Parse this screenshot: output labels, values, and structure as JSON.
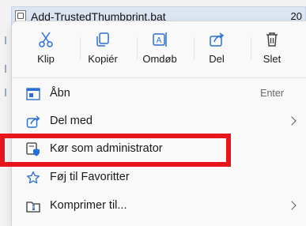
{
  "file": {
    "name": "Add-TrustedThumbprint.bat",
    "date_fragment": "20"
  },
  "toolbar": {
    "cut_label": "Klip",
    "copy_label": "Kopiér",
    "rename_label": "Omdøb",
    "share_label": "Del",
    "delete_label": "Slet"
  },
  "menu": {
    "items": [
      {
        "label": "Åbn",
        "shortcut": "Enter",
        "icon": "open-icon"
      },
      {
        "label": "Del med",
        "icon": "share-with-icon",
        "submenu": true
      },
      {
        "label": "Kør som administrator",
        "icon": "run-as-admin-icon",
        "highlighted": true
      },
      {
        "label": "Føj til Favoritter",
        "icon": "star-icon"
      },
      {
        "label": "Komprimer til...",
        "icon": "zip-icon",
        "submenu": true
      }
    ]
  },
  "colors": {
    "highlight": "#e8141c",
    "accent": "#2b6fd6",
    "admin_shield": "#1f6fe0"
  }
}
